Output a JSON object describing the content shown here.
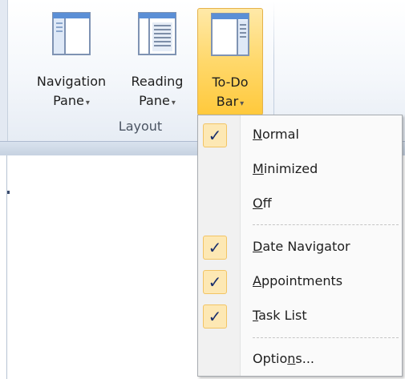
{
  "ribbon": {
    "commands": [
      {
        "line1": "Navigation",
        "line2": "Pane",
        "icon": "navigation-pane-icon"
      },
      {
        "line1": "Reading",
        "line2": "Pane",
        "icon": "reading-pane-icon"
      },
      {
        "line1": "To-Do",
        "line2": "Bar",
        "icon": "todo-bar-icon"
      }
    ],
    "dropdown_arrow": "▾",
    "group_label": "Layout"
  },
  "menu": {
    "check_glyph": "✓",
    "items": [
      {
        "label": "Normal",
        "checked": true
      },
      {
        "label": "Minimized",
        "checked": false
      },
      {
        "label": "Off",
        "checked": false
      },
      {
        "label": "Date Navigator",
        "checked": true
      },
      {
        "label": "Appointments",
        "checked": true
      },
      {
        "label": "Task List",
        "checked": true
      },
      {
        "label": "Options...",
        "checked": false
      }
    ]
  },
  "colors": {
    "active_button": "#ffd86b",
    "check_background": "#fde8b4",
    "check_border": "#f2c465"
  }
}
